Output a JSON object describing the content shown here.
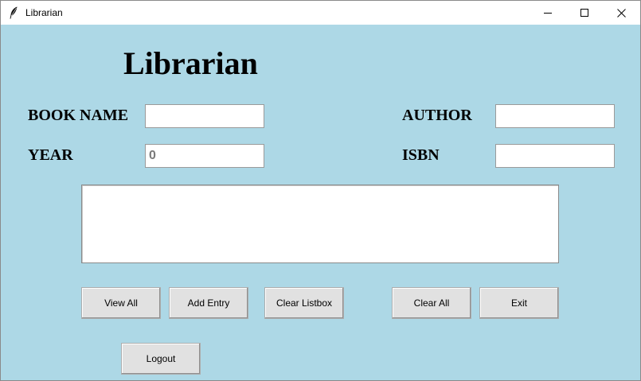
{
  "window": {
    "title": "Librarian",
    "controls": [
      "minimize-icon",
      "maximize-icon",
      "close-icon"
    ]
  },
  "heading": "Librarian",
  "form": {
    "book_name_label": "BOOK NAME",
    "book_name_value": "",
    "author_label": "AUTHOR",
    "author_value": "",
    "year_label": "YEAR",
    "year_value": "0",
    "isbn_label": "ISBN",
    "isbn_value": ""
  },
  "listbox": {
    "items": []
  },
  "buttons": {
    "view_all": "View All",
    "add_entry": "Add Entry",
    "clear_listbox": "Clear Listbox",
    "clear_all": "Clear All",
    "exit": "Exit",
    "logout": "Logout"
  },
  "colors": {
    "background": "#add8e6",
    "titlebar": "#ffffff",
    "button_face": "#e1e1e1"
  }
}
